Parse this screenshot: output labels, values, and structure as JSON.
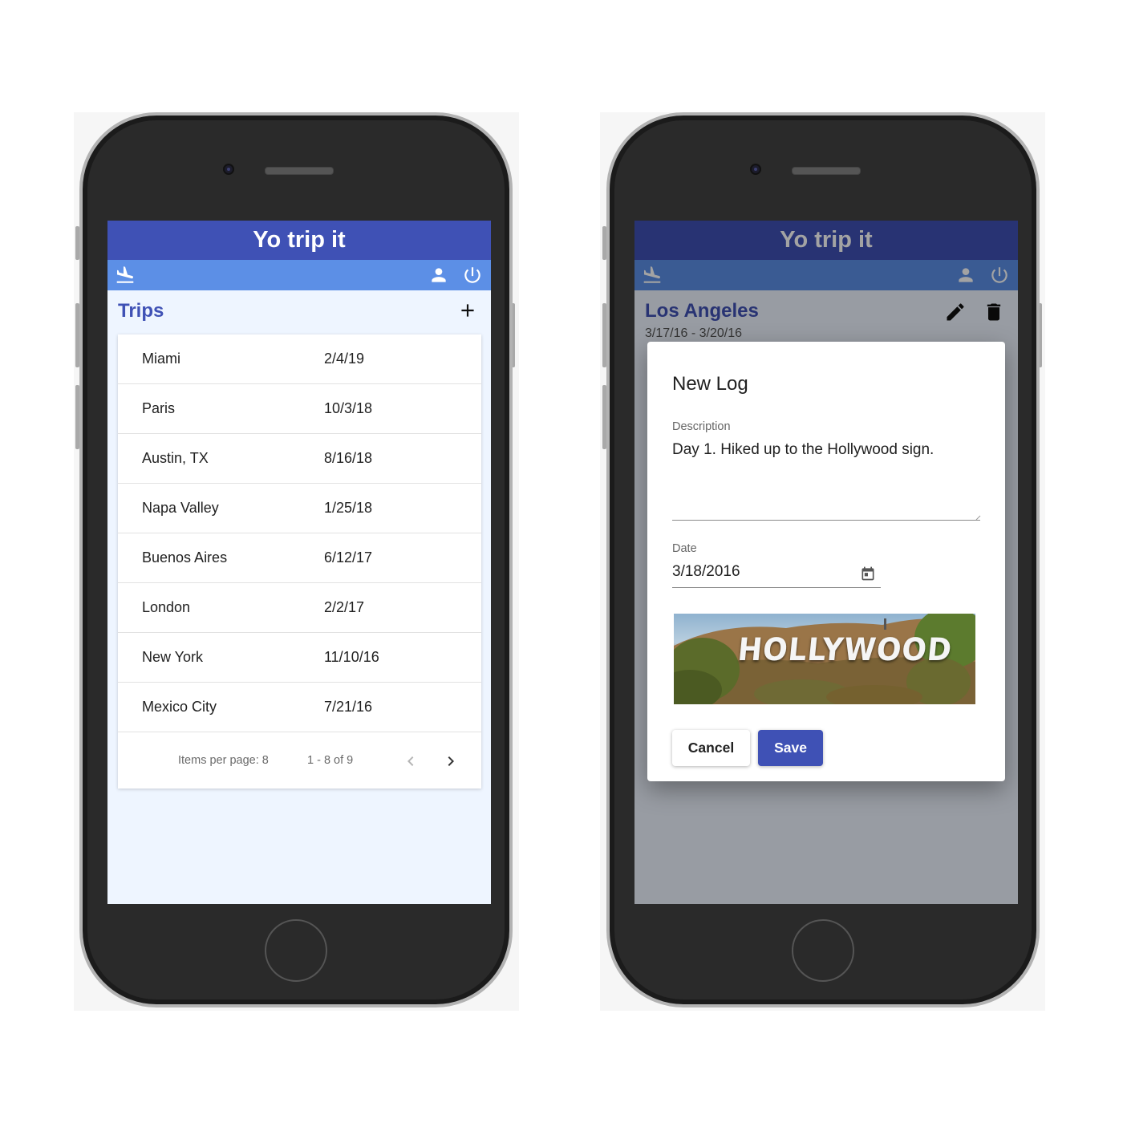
{
  "left_phone": {
    "app_title": "Yo trip it",
    "nav": {
      "logo_icon": "flight-land-icon",
      "profile_icon": "person-icon",
      "power_icon": "power-icon"
    },
    "header": {
      "title": "Trips",
      "add_icon": "plus-icon"
    },
    "trips": [
      {
        "name": "Miami",
        "date": "2/4/19"
      },
      {
        "name": "Paris",
        "date": "10/3/18"
      },
      {
        "name": "Austin, TX",
        "date": "8/16/18"
      },
      {
        "name": "Napa Valley",
        "date": "1/25/18"
      },
      {
        "name": "Buenos Aires",
        "date": "6/12/17"
      },
      {
        "name": "London",
        "date": "2/2/17"
      },
      {
        "name": "New York",
        "date": "11/10/16"
      },
      {
        "name": "Mexico City",
        "date": "7/21/16"
      }
    ],
    "paginator": {
      "items_per_page": "Items per page: 8",
      "range": "1 - 8 of 9",
      "prev_icon": "chevron-left-icon",
      "next_icon": "chevron-right-icon"
    }
  },
  "right_phone": {
    "app_title": "Yo trip it",
    "nav": {
      "logo_icon": "flight-land-icon",
      "profile_icon": "person-icon",
      "power_icon": "power-icon"
    },
    "header": {
      "title": "Los Angeles",
      "date_range": "3/17/16 - 3/20/16",
      "edit_icon": "pencil-icon",
      "delete_icon": "trash-icon"
    },
    "dialog": {
      "title": "New Log",
      "description_label": "Description",
      "description_value": "Day 1. Hiked up to the Hollywood sign.",
      "date_label": "Date",
      "date_value": "3/18/2016",
      "calendar_icon": "calendar-icon",
      "image_sign_text": "HOLLYWOOD",
      "cancel_label": "Cancel",
      "save_label": "Save"
    }
  },
  "colors": {
    "primary": "#3f51b5",
    "nav_bar": "#5c8fe6",
    "page_background": "#eef5ff"
  }
}
